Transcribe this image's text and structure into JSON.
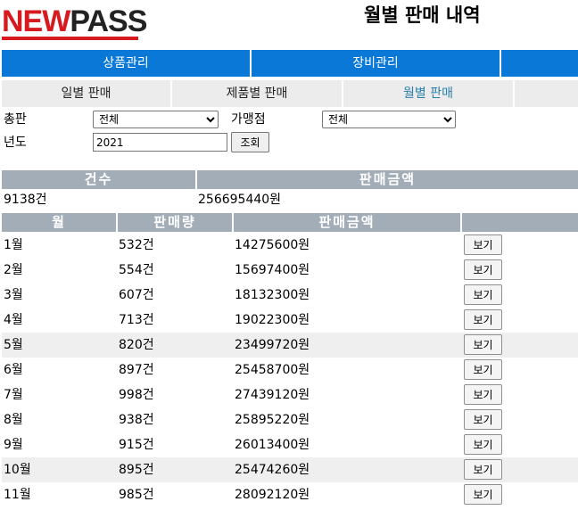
{
  "brand": {
    "logo_part1": "NEW",
    "logo_part2": "PASS"
  },
  "page_title": "월별 판매 내역",
  "top_nav": [
    "상품관리",
    "장비관리",
    ""
  ],
  "sub_nav": {
    "items": [
      "일별 판매",
      "제품별 판매",
      "월별 판매",
      ""
    ],
    "active_index": 2
  },
  "filters": {
    "distributor_label": "총판",
    "distributor_value": "전체",
    "franchise_label": "가맹점",
    "franchise_value": "전체",
    "year_label": "년도",
    "year_value": "2021",
    "search_button": "조회"
  },
  "summary": {
    "headers": [
      "건수",
      "판매금액"
    ],
    "count": "9138건",
    "amount": "256695440원"
  },
  "table": {
    "headers": [
      "월",
      "판매량",
      "판매금액",
      ""
    ],
    "view_button": "보기",
    "rows": [
      {
        "month": "1월",
        "qty": "532건",
        "amount": "14275600원"
      },
      {
        "month": "2월",
        "qty": "554건",
        "amount": "15697400원"
      },
      {
        "month": "3월",
        "qty": "607건",
        "amount": "18132300원"
      },
      {
        "month": "4월",
        "qty": "713건",
        "amount": "19022300원"
      },
      {
        "month": "5월",
        "qty": "820건",
        "amount": "23499720원"
      },
      {
        "month": "6월",
        "qty": "897건",
        "amount": "25458700원"
      },
      {
        "month": "7월",
        "qty": "998건",
        "amount": "27439120원"
      },
      {
        "month": "8월",
        "qty": "938건",
        "amount": "25895220원"
      },
      {
        "month": "9월",
        "qty": "915건",
        "amount": "26013400원"
      },
      {
        "month": "10월",
        "qty": "895건",
        "amount": "25474260원"
      },
      {
        "month": "11월",
        "qty": "985건",
        "amount": "28092120원"
      }
    ]
  },
  "colors": {
    "nav_blue": "#0a78d7",
    "header_gray": "#a3adb8",
    "logo_red": "#d71920",
    "active_tab": "#2a7fa8"
  }
}
